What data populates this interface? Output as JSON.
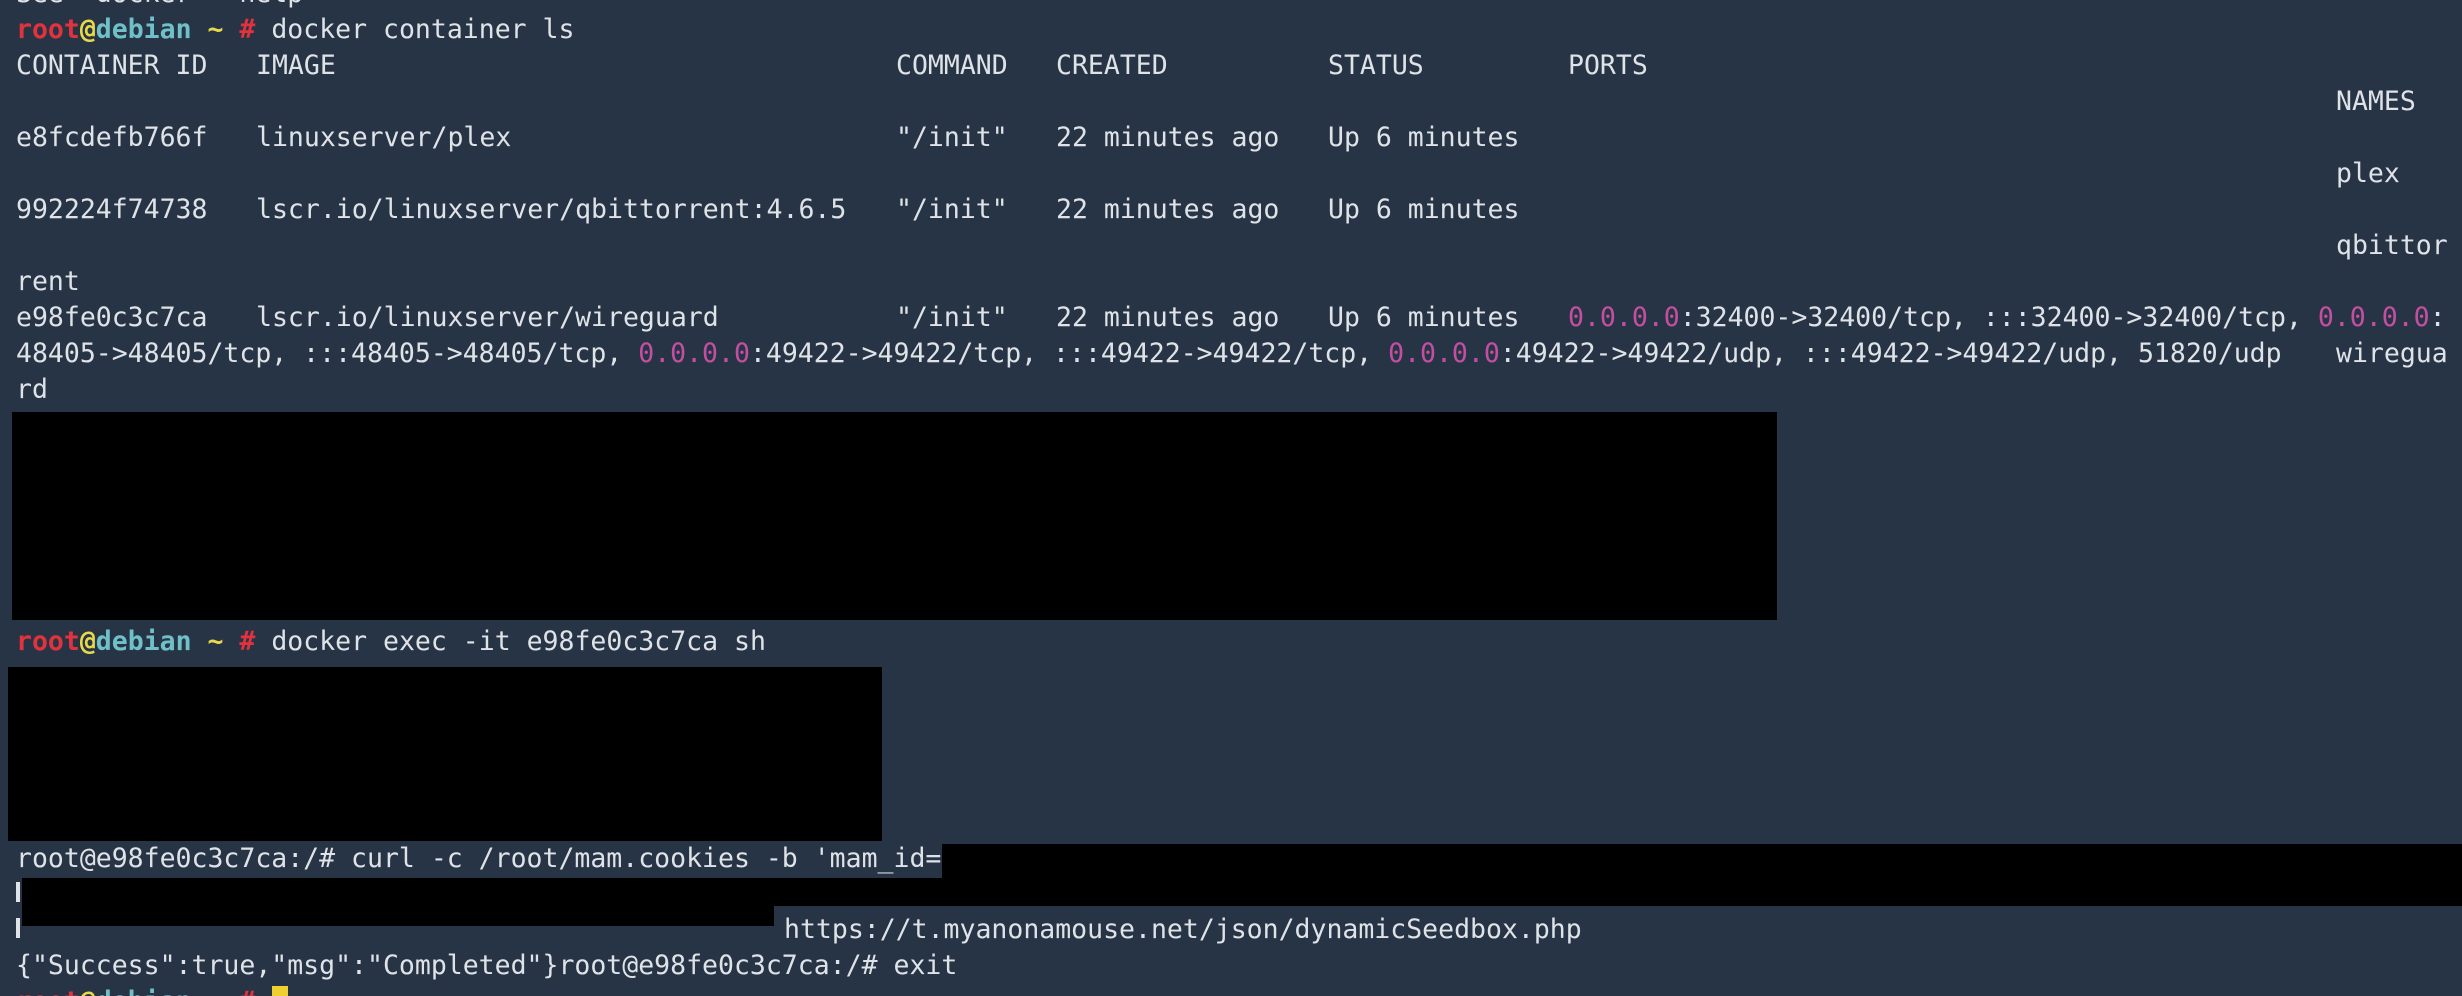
{
  "terminal": {
    "top_fragment": "See 'docker --help'",
    "prompt": {
      "user": "root",
      "at": "@",
      "host": "debian",
      "dir": " ~ ",
      "hash": "#"
    },
    "cmd1": " docker container ls",
    "headers": {
      "id": "CONTAINER ID",
      "image": "IMAGE",
      "command": "COMMAND",
      "created": "CREATED",
      "status": "STATUS",
      "ports": "PORTS",
      "names": "NAMES"
    },
    "rows": [
      {
        "id": "e8fcdefb766f",
        "image": "linuxserver/plex",
        "command": "\"/init\"",
        "created": "22 minutes ago",
        "status": "Up 6 minutes",
        "name": "plex"
      },
      {
        "id": "992224f74738",
        "image": "lscr.io/linuxserver/qbittorrent:4.6.5",
        "command": "\"/init\"",
        "created": "22 minutes ago",
        "status": "Up 6 minutes",
        "name": "qbittor",
        "name_wrap": "rent"
      },
      {
        "id": "e98fe0c3c7ca",
        "image": "lscr.io/linuxserver/wireguard",
        "command": "\"/init\"",
        "created": "22 minutes ago",
        "status": "Up 6 minutes",
        "name": "wiregua",
        "name_wrap": "rd"
      }
    ],
    "ports": {
      "ip": "0.0.0.0",
      "l1_a": ":32400->32400/tcp, :::32400->32400/tcp, ",
      "l1_b": ":",
      "l2_a": "48405->48405/tcp, :::48405->48405/tcp, ",
      "l2_b": ":49422->49422/tcp, :::49422->49422/tcp, ",
      "l2_c": ":49422->49422/udp, :::49422->49422/udp, 51820/udp"
    },
    "cmd2": " docker exec -it e98fe0c3c7ca sh",
    "curl_line": "root@e98fe0c3c7ca:/# curl -c /root/mam.cookies -b 'mam_id=",
    "url": "https://t.myanonamouse.net/json/dynamicSeedbox.php",
    "result_line": "{\"Success\":true,\"msg\":\"Completed\"}root@e98fe0c3c7ca:/# exit"
  }
}
